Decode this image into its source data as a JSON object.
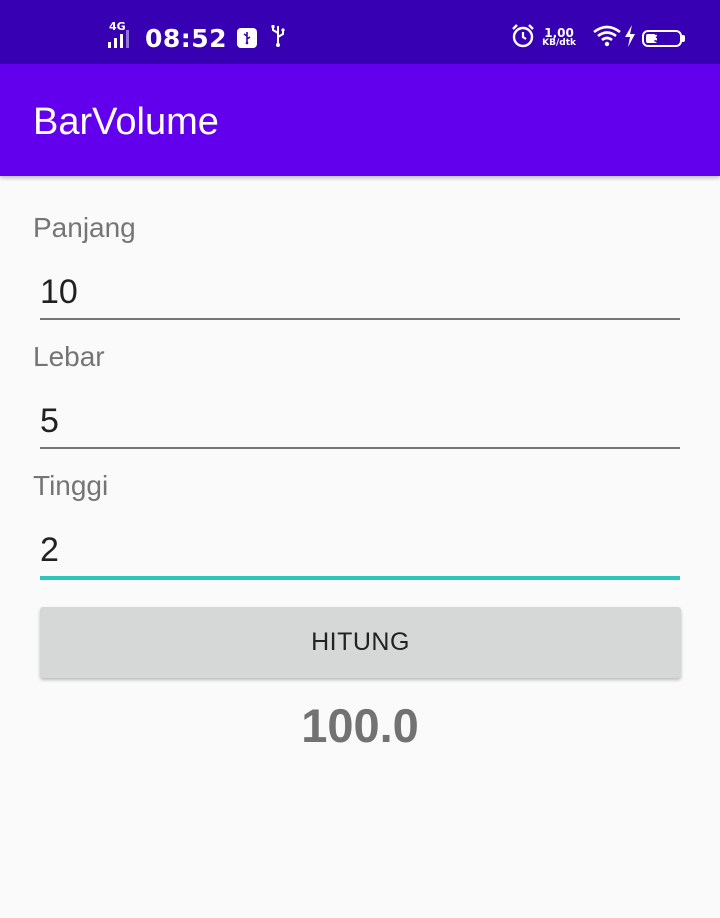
{
  "status_bar": {
    "network": "4G",
    "time": "08:52",
    "speed_value": "1,00",
    "speed_unit": "KB/dtk",
    "battery": "34",
    "battery_level": 0.34,
    "background": "#3700b3"
  },
  "app_bar": {
    "title": "BarVolume",
    "background": "#6200ee"
  },
  "form": {
    "panjang_label": "Panjang",
    "panjang_value": "10",
    "lebar_label": "Lebar",
    "lebar_value": "5",
    "tinggi_label": "Tinggi",
    "tinggi_value": "2",
    "focus_color": "#2ec6bb"
  },
  "actions": {
    "hitung_label": "HITUNG"
  },
  "result": {
    "value": "100.0"
  }
}
